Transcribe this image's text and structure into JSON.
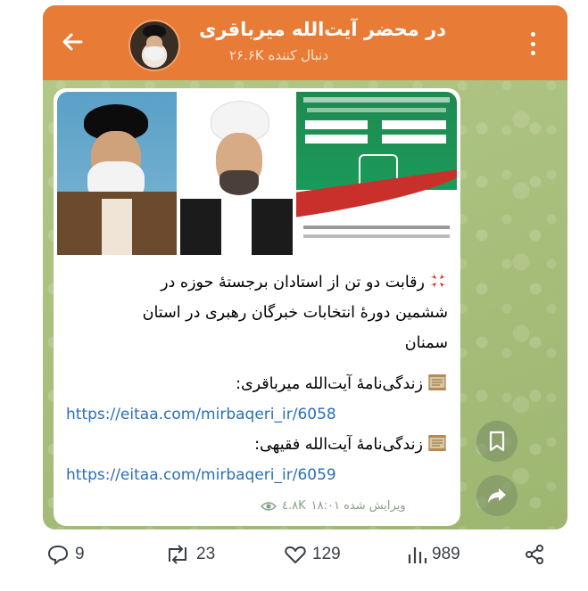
{
  "header": {
    "title": "در محضر آیت‌الله میرباقری",
    "subtitle": "دنبال کننده ۲۶.۶K"
  },
  "post": {
    "caption_lines": [
      "رقابت دو تن از استادان برجستهٔ حوزه در",
      "ششمین دورهٔ انتخابات خبرگان رهبری در استان",
      "سمنان"
    ],
    "bio1_label": "زندگی‌نامهٔ آیت‌الله میرباقری:",
    "bio1_link": "https://eitaa.com/mirbaqeri_ir/6058",
    "bio2_label": "زندگی‌نامهٔ آیت‌الله فقیهی:",
    "bio2_link": "https://eitaa.com/mirbaqeri_ir/6059",
    "views": "٤.٨K",
    "edited": "ویرایش شده ۱۸:۰۱"
  },
  "footer": {
    "replies": "9",
    "reposts": "23",
    "likes": "129",
    "views": "989"
  },
  "colors": {
    "header": "#e87b35",
    "link": "#2a6fb6",
    "chat_bg": "#a9c07e"
  }
}
